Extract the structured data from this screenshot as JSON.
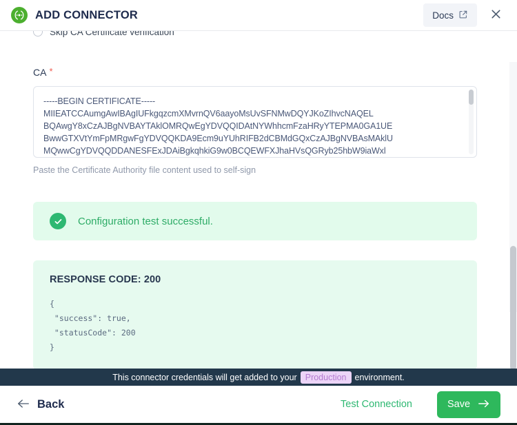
{
  "header": {
    "title": "ADD CONNECTOR",
    "brand_icon": "connector-icon",
    "docs_label": "Docs",
    "docs_icon": "external-link-icon",
    "close_icon": "close-icon"
  },
  "form": {
    "skip_ca_option": "Skip CA Certificate verification",
    "ca_label": "CA",
    "required_marker": "*",
    "ca_value": "-----BEGIN CERTIFICATE-----\nMIIEATCCAumgAwIBAgIUFkgqzcmXMvrnQV6aayoMsUvSFNMwDQYJKoZIhvcNAQEL\nBQAwgY8xCzAJBgNVBAYTAklOMRQwEgYDVQQIDAtNYWhhcmFzaHRyYTEPMA0GA1UE\nBwwGTXVtYmFpMRgwFgYDVQQKDA9Ecm9uYUhRIFB2dCBMdGQxCzAJBgNVBAsMAklU\nMQwwCgYDVQQDDANESFExJDAiBgkqhkiG9w0BCQEWFXJhaHVsQGRyb25hbW9iaWxl",
    "ca_helper": "Paste the Certificate Authority file content used to self-sign"
  },
  "alert": {
    "icon": "check-circle-icon",
    "message": "Configuration test successful.",
    "color": "#2eac67",
    "background": "#e2fbec"
  },
  "response": {
    "title": "RESPONSE CODE: 200",
    "status_code": 200,
    "body": "{\n \"success\": true,\n \"statusCode\": 200\n}"
  },
  "notice": {
    "text_before": "This connector credentials will get added to your",
    "environment": "Production",
    "text_after": "environment.",
    "badge_color": "#ecd4f7",
    "bar_color": "#22384b"
  },
  "footer": {
    "back_label": "Back",
    "back_icon": "arrow-left-icon",
    "test_connection_label": "Test Connection",
    "save_label": "Save",
    "save_icon": "arrow-right-icon",
    "save_color": "#2eb85c"
  }
}
